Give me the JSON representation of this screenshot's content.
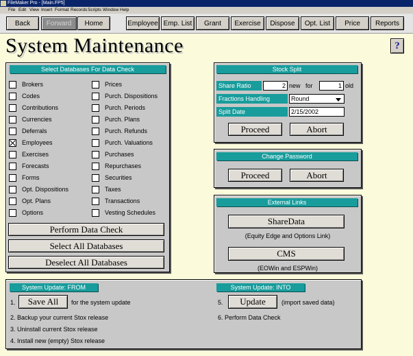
{
  "window": {
    "title": "FileMaker Pro - [Main.FP5]"
  },
  "menu": [
    "File",
    "Edit",
    "View",
    "Insert",
    "Format",
    "Records",
    "Scripts",
    "Window",
    "Help"
  ],
  "nav": {
    "back": "Back",
    "forward": "Forward",
    "home": "Home",
    "employee": "Employee",
    "emp_list": "Emp. List",
    "grant": "Grant",
    "exercise": "Exercise",
    "dispose": "Dispose",
    "opt_list": "Opt. List",
    "price": "Price",
    "reports": "Reports"
  },
  "page": {
    "title": "System Maintenance",
    "help": "?"
  },
  "databases": {
    "header": "Select Databases For Data Check",
    "left": [
      {
        "label": "Brokers",
        "checked": false
      },
      {
        "label": "Codes",
        "checked": false
      },
      {
        "label": "Contributions",
        "checked": false
      },
      {
        "label": "Currencies",
        "checked": false
      },
      {
        "label": "Deferrals",
        "checked": false
      },
      {
        "label": "Employees",
        "checked": true
      },
      {
        "label": "Exercises",
        "checked": false
      },
      {
        "label": "Forecasts",
        "checked": false
      },
      {
        "label": "Forms",
        "checked": false
      },
      {
        "label": "Opt. Dispositions",
        "checked": false
      },
      {
        "label": "Opt. Plans",
        "checked": false
      },
      {
        "label": "Options",
        "checked": false
      }
    ],
    "right": [
      {
        "label": "Prices",
        "checked": false
      },
      {
        "label": "Purch. Dispositions",
        "checked": false
      },
      {
        "label": "Purch. Periods",
        "checked": false
      },
      {
        "label": "Purch. Plans",
        "checked": false
      },
      {
        "label": "Purch. Refunds",
        "checked": false
      },
      {
        "label": "Purch. Valuations",
        "checked": false
      },
      {
        "label": "Purchases",
        "checked": false
      },
      {
        "label": "Repurchases",
        "checked": false
      },
      {
        "label": "Securities",
        "checked": false
      },
      {
        "label": "Taxes",
        "checked": false
      },
      {
        "label": "Transactions",
        "checked": false
      },
      {
        "label": "Vesting Schedules",
        "checked": false
      }
    ],
    "perform": "Perform Data Check",
    "select_all": "Select All Databases",
    "deselect_all": "Deselect All Databases"
  },
  "split": {
    "header": "Stock Split",
    "share_ratio_label": "Share Ratio",
    "ratio_new": "2",
    "new_text": "new",
    "for_text": "for",
    "ratio_old": "1",
    "old_text": "old",
    "fractions_label": "Fractions Handling",
    "fractions_value": "Round",
    "date_label": "Split Date",
    "date_value": "2/15/2002",
    "proceed": "Proceed",
    "abort": "Abort"
  },
  "password": {
    "header": "Change Password",
    "proceed": "Proceed",
    "abort": "Abort"
  },
  "links": {
    "header": "External Links",
    "sharedata": "ShareData",
    "sharedata_desc": "(Equity Edge and Options Link)",
    "cms": "CMS",
    "cms_desc": "(EOWin and ESPWin)"
  },
  "update": {
    "from_header": "System Update: FROM",
    "into_header": "System Update: INTO",
    "step1_num": "1.",
    "save_all": "Save All",
    "step1_text": "for the system update",
    "step2": "2. Backup your current Stox release",
    "step3": "3. Uninstall current Stox release",
    "step4": "4. Install new (empty) Stox release",
    "step5_num": "5.",
    "update_btn": "Update",
    "step5_text": "(import saved data)",
    "step6": "6. Perform Data Check"
  },
  "colors": {
    "header_teal": "#189c9c",
    "panel_gray": "#c8c8c8",
    "page_bg": "#fbfbdc"
  }
}
